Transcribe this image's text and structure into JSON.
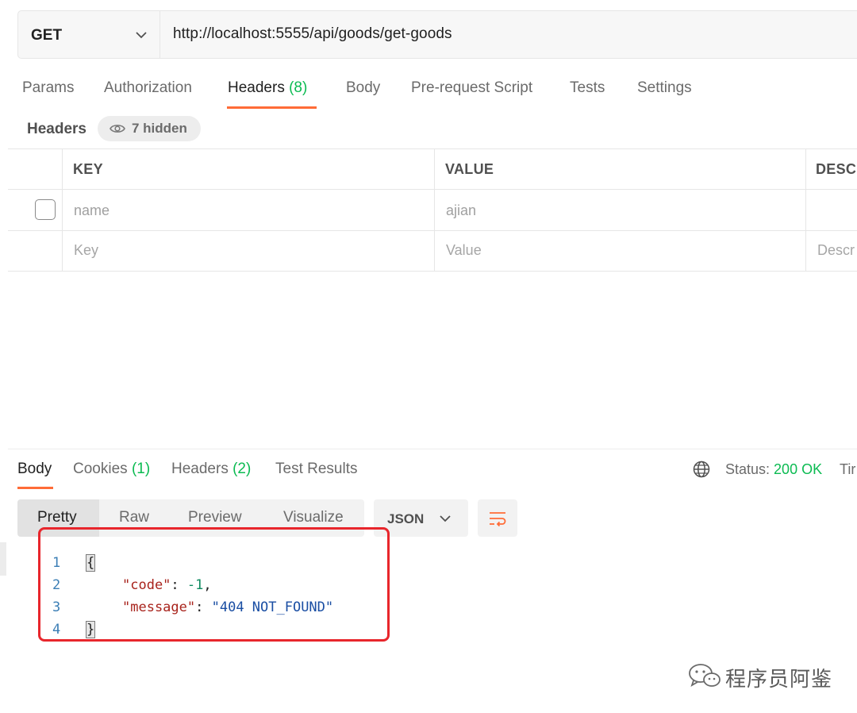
{
  "request": {
    "method": "GET",
    "url": "http://localhost:5555/api/goods/get-goods"
  },
  "request_tabs": [
    {
      "label": "Params"
    },
    {
      "label": "Authorization"
    },
    {
      "label": "Headers",
      "count": "(8)"
    },
    {
      "label": "Body"
    },
    {
      "label": "Pre-request Script"
    },
    {
      "label": "Tests"
    },
    {
      "label": "Settings"
    }
  ],
  "headers_section": {
    "title": "Headers",
    "hidden_label": "7 hidden",
    "columns": {
      "key": "KEY",
      "value": "VALUE",
      "description": "DESC"
    },
    "rows": [
      {
        "key": "name",
        "value": "ajian",
        "checked": false
      }
    ],
    "placeholder": {
      "key": "Key",
      "value": "Value",
      "description": "Descr"
    }
  },
  "response_tabs": [
    {
      "label": "Body"
    },
    {
      "label": "Cookies",
      "count": "(1)"
    },
    {
      "label": "Headers",
      "count": "(2)"
    },
    {
      "label": "Test Results"
    }
  ],
  "status": {
    "label": "Status:",
    "value": "200 OK",
    "time_label": "Tir"
  },
  "view_modes": [
    "Pretty",
    "Raw",
    "Preview",
    "Visualize"
  ],
  "format": "JSON",
  "code": {
    "line_numbers": [
      "1",
      "2",
      "3",
      "4"
    ],
    "open_brace": "{",
    "close_brace": "}",
    "code_key": "\"code\"",
    "code_value": "-1",
    "message_key": "\"message\"",
    "message_value": "\"404 NOT_FOUND\"",
    "colon": ": ",
    "comma": ","
  },
  "watermark": "程序员阿鉴",
  "colors": {
    "accent": "#ff6c37",
    "success": "#0cbb52",
    "highlight_box": "#e8262c"
  }
}
